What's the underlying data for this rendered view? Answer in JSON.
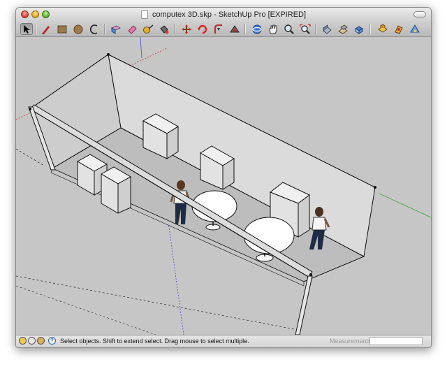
{
  "window": {
    "title": "computex 3D.skp - SketchUp Pro [EXPIRED]"
  },
  "toolbar": {
    "tools": [
      "select-arrow-icon",
      "pencil-icon",
      "rectangle-icon",
      "circle-icon",
      "arc-icon",
      "push-pull-icon",
      "eraser-icon",
      "tape-measure-icon",
      "paint-bucket-icon",
      "move-icon",
      "rotate-icon",
      "orbit-icon",
      "follow-me-icon",
      "offset-icon",
      "pan-icon",
      "zoom-icon",
      "zoom-extents-icon",
      "previous-view-icon",
      "next-view-icon",
      "standard-views-icon",
      "components-icon",
      "materials-icon",
      "scenes-icon"
    ]
  },
  "scene": {
    "axis_colors": {
      "red": "#c63c3c",
      "green": "#3dab3d",
      "blue": "#4a4ad2"
    },
    "figures": 2,
    "tables": 2,
    "cabinets": 5
  },
  "statusbar": {
    "message": "Select objects. Shift to extend select. Drag mouse to select multiple.",
    "help_glyph": "?",
    "measurements_label": "Measurements",
    "measurements_value": ""
  }
}
